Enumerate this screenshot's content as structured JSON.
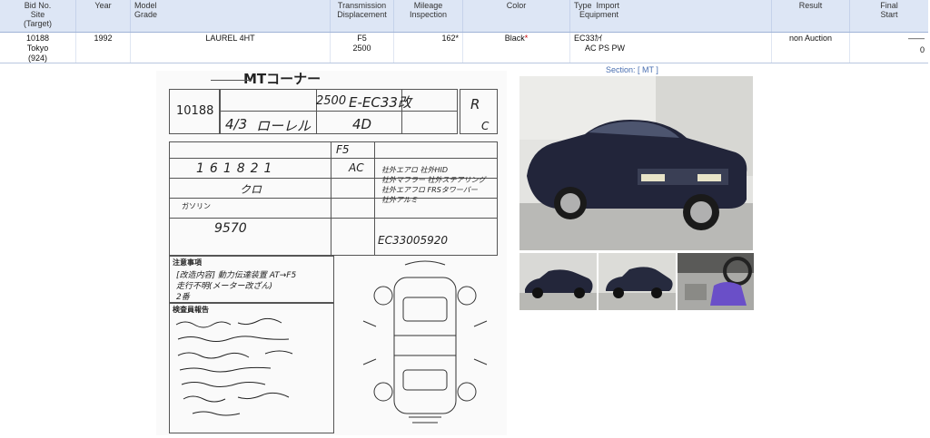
{
  "header": {
    "bid_no": "Bid No.",
    "site": "Site",
    "target": "(Target)",
    "year": "Year",
    "model": "Model",
    "grade": "Grade",
    "transmission": "Transmission",
    "displacement": "Displacement",
    "mileage": "Mileage",
    "inspection": "Inspection",
    "color": "Color",
    "type": "Type",
    "import": "Import",
    "equipment": "Equipment",
    "result": "Result",
    "final": "Final",
    "start": "Start"
  },
  "lot": {
    "bid_no": "10188",
    "site": "Tokyo",
    "target": "(924)",
    "year": "1992",
    "model_grade": "LAUREL 4HT",
    "transmission": "F5",
    "displacement": "2500",
    "mileage": "162",
    "mileage_mark": "*",
    "color": "Black",
    "color_mark": "*",
    "type": "EC33ｶｲ",
    "equipment": "AC PS PW",
    "result": "non Auction",
    "final": "——",
    "start": "0"
  },
  "section": {
    "label": "Section:",
    "value": "MT"
  },
  "sheet": {
    "title": "MTコーナー",
    "lot_number": "10188",
    "displacement": "2500",
    "model_code": "E-EC33改",
    "grade_r": "R",
    "grade_c": "C",
    "year": "4/3",
    "name": "ローレル",
    "doors": "4D",
    "shift": "F5",
    "ac": "AC",
    "mileage": "161821",
    "color": "クロ",
    "fuel": "ガソリン",
    "price": "9570",
    "chassis": "EC33005920",
    "notes_title": "注意事項",
    "notes": [
      "[改造内容] 動力伝達装置 AT→F5",
      "走行不明(メーター改ざん)",
      "2番"
    ],
    "report_title": "検査員報告",
    "mods": [
      "社外エアロ",
      "社外HID",
      "社外マフラー",
      "社外ステアリング",
      "社外エアフロ",
      "FRSタワーバー",
      "社外アルミ"
    ]
  },
  "photos": {
    "main": "car-front-photo",
    "t1": "car-side-photo",
    "t2": "car-rear-photo",
    "t3": "interior-photo"
  }
}
